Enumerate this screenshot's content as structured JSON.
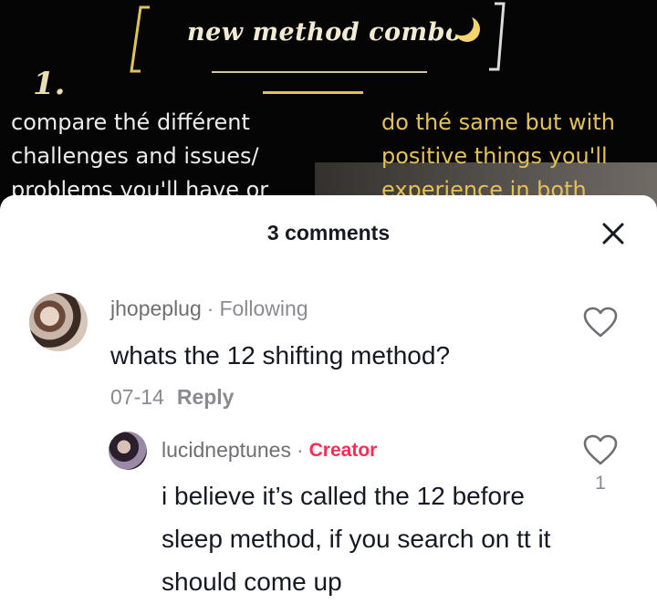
{
  "video": {
    "title": "new method combo",
    "step_number": "1.",
    "left_text": "compare thé différent challenges and issues/ problems you'll have or",
    "right_text": "do thé same but with positive things you'll experience in both"
  },
  "comments_sheet": {
    "count_label": "3 comments",
    "close_icon": "close-icon",
    "comments": [
      {
        "username": "jhopeplug",
        "separator": "·",
        "relation": "Following",
        "text": "whats the 12 shifting method?",
        "date": "07-14",
        "reply_label": "Reply",
        "like_icon": "heart-outline-icon"
      }
    ],
    "replies": [
      {
        "username": "lucidneptunes",
        "separator": "·",
        "badge": "Creator",
        "text": "i believe it’s called the 12 before sleep method, if you search on tt it should come up",
        "like_count": "1",
        "like_icon": "heart-outline-icon"
      }
    ]
  },
  "colors": {
    "creator_badge": "#fe2c55",
    "secondary_text": "#8a8b91",
    "primary_text": "#161823",
    "video_accent": "#e0c25c"
  }
}
